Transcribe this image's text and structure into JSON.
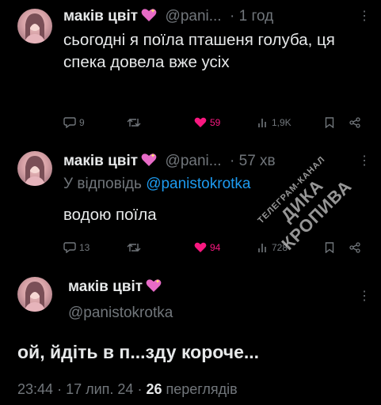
{
  "tweets": [
    {
      "author": "маків цвіт",
      "handle": "@pani...",
      "time": "· 1 год",
      "text": "сьогодні я поїла пташеня голуба, ця спека довела вже усіх",
      "replies": "9",
      "retweets": "",
      "likes": "59",
      "views": "1,9K"
    },
    {
      "author": "маків цвіт",
      "handle": "@pani...",
      "time": "· 57 хв",
      "reply_prefix": "У відповідь",
      "reply_to": "@panistokrotka",
      "text": "водою поїла",
      "replies": "13",
      "retweets": "",
      "likes": "94",
      "views": "728"
    }
  ],
  "main_tweet": {
    "author": "маків цвіт",
    "handle": "@panistokrotka",
    "text": "ой, йдіть в п...зду короче...",
    "time": "23:44",
    "date": "17 лип. 24",
    "views_count": "26",
    "views_label": "переглядів"
  },
  "watermark": {
    "line1": "ТЕЛЕГРАМ-КАНАЛ",
    "line2": "ДИКА КРОПИВА"
  },
  "colors": {
    "background": "#000000",
    "text": "#e7e9ea",
    "muted": "#71767b",
    "link": "#1d9bf0",
    "like": "#f91880"
  }
}
